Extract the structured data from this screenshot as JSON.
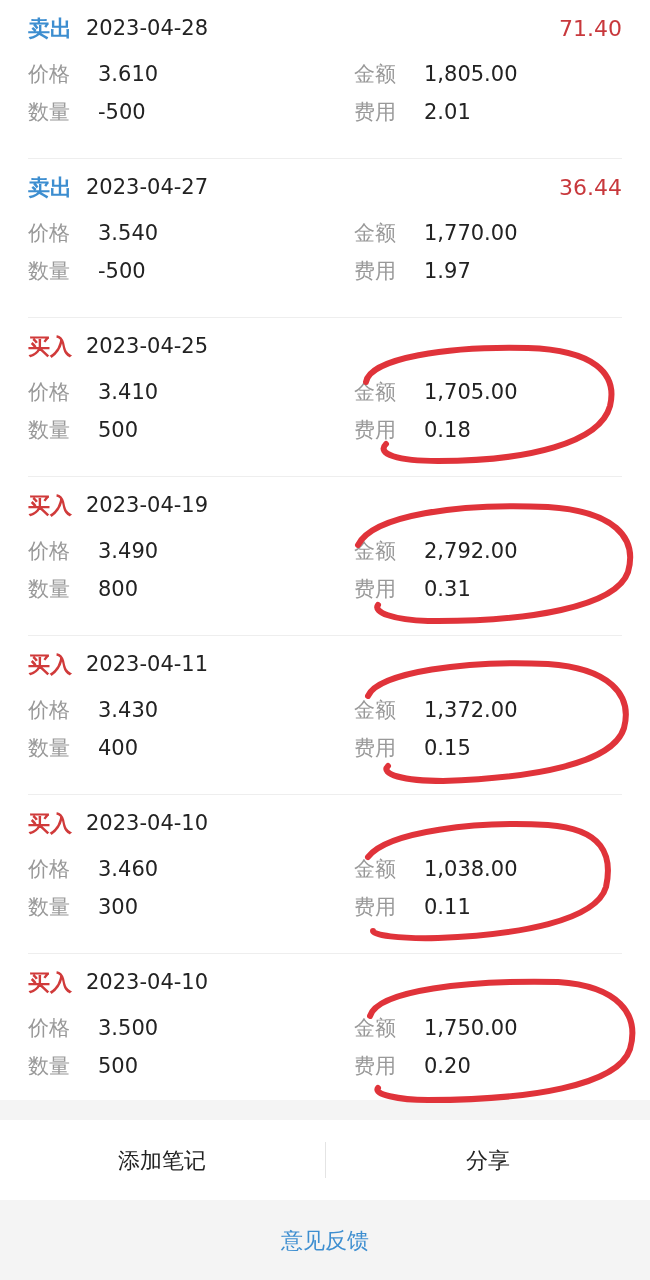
{
  "trades": [
    {
      "kind": "sell",
      "type": "卖出",
      "date": "2023-04-28",
      "profit": "71.40",
      "circled": false,
      "fields": [
        {
          "label": "价格",
          "value": "3.610"
        },
        {
          "label": "金额",
          "value": "1,805.00"
        },
        {
          "label": "数量",
          "value": "-500"
        },
        {
          "label": "费用",
          "value": "2.01"
        }
      ]
    },
    {
      "kind": "sell",
      "type": "卖出",
      "date": "2023-04-27",
      "profit": "36.44",
      "circled": false,
      "fields": [
        {
          "label": "价格",
          "value": "3.540"
        },
        {
          "label": "金额",
          "value": "1,770.00"
        },
        {
          "label": "数量",
          "value": "-500"
        },
        {
          "label": "费用",
          "value": "1.97"
        }
      ]
    },
    {
      "kind": "buy",
      "type": "买入",
      "date": "2023-04-25",
      "circled": true,
      "fields": [
        {
          "label": "价格",
          "value": "3.410"
        },
        {
          "label": "金额",
          "value": "1,705.00"
        },
        {
          "label": "数量",
          "value": "500"
        },
        {
          "label": "费用",
          "value": "0.18"
        }
      ]
    },
    {
      "kind": "buy",
      "type": "买入",
      "date": "2023-04-19",
      "circled": true,
      "fields": [
        {
          "label": "价格",
          "value": "3.490"
        },
        {
          "label": "金额",
          "value": "2,792.00"
        },
        {
          "label": "数量",
          "value": "800"
        },
        {
          "label": "费用",
          "value": "0.31"
        }
      ]
    },
    {
      "kind": "buy",
      "type": "买入",
      "date": "2023-04-11",
      "circled": true,
      "fields": [
        {
          "label": "价格",
          "value": "3.430"
        },
        {
          "label": "金额",
          "value": "1,372.00"
        },
        {
          "label": "数量",
          "value": "400"
        },
        {
          "label": "费用",
          "value": "0.15"
        }
      ]
    },
    {
      "kind": "buy",
      "type": "买入",
      "date": "2023-04-10",
      "circled": true,
      "fields": [
        {
          "label": "价格",
          "value": "3.460"
        },
        {
          "label": "金额",
          "value": "1,038.00"
        },
        {
          "label": "数量",
          "value": "300"
        },
        {
          "label": "费用",
          "value": "0.11"
        }
      ]
    },
    {
      "kind": "buy",
      "type": "买入",
      "date": "2023-04-10",
      "circled": true,
      "fields": [
        {
          "label": "价格",
          "value": "3.500"
        },
        {
          "label": "金额",
          "value": "1,750.00"
        },
        {
          "label": "数量",
          "value": "500"
        },
        {
          "label": "费用",
          "value": "0.20"
        }
      ]
    }
  ],
  "actions": [
    "添加笔记",
    "分享"
  ],
  "feedback": "意见反馈"
}
